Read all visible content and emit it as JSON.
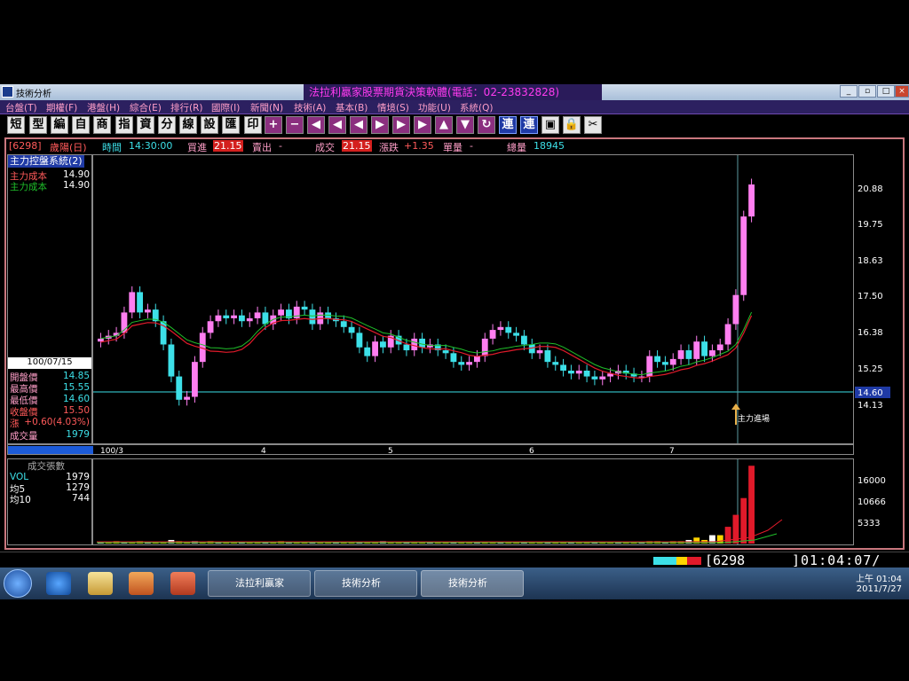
{
  "window": {
    "title": "技術分析",
    "banner": "法拉利贏家股票期貨決策軟體(電話：02-23832828)"
  },
  "menu": [
    "台盤(T)",
    "期權(F)",
    "港盤(H)",
    "綜合(E)",
    "排行(R)",
    "國際(I)",
    "新聞(N)",
    "技術(A)",
    "基本(B)",
    "情境(S)",
    "功能(U)",
    "系統(Q)"
  ],
  "toolbar": [
    "短",
    "型",
    "編",
    "自",
    "商",
    "指",
    "資",
    "分",
    "線",
    "設",
    "匯",
    "印",
    "+",
    "−",
    "◀",
    "◀",
    "◀",
    "▶",
    "▶",
    "▶",
    "▲",
    "▼",
    "↻",
    "連",
    "連",
    "▣",
    "🔒",
    "✂"
  ],
  "info": {
    "code": "[6298]",
    "name": "歲陽(日)",
    "time_label": "時間",
    "time": "14:30:00",
    "bid_label": "買進",
    "bid": "21.15",
    "ask_label": "賣出",
    "ask": "-",
    "trade_label": "成交",
    "trade": "21.15",
    "change_label": "漲跌",
    "change": "+1.35",
    "vol_label": "單量",
    "vol": "-",
    "total_label": "總量",
    "total": "18945"
  },
  "left": {
    "indicator": "主力控盤系統(2)",
    "cost1_label": "主力成本",
    "cost1": "14.90",
    "cost2_label": "主力成本",
    "cost2": "14.90",
    "date": "100/07/15",
    "open_label": "開盤價",
    "open": "14.85",
    "high_label": "最高價",
    "high": "15.55",
    "low_label": "最低價",
    "low": "14.60",
    "close_label": "收盤價",
    "close": "15.50",
    "chg_label": "漲",
    "chg": "+0.60(4.03%)",
    "volume_label": "成交量",
    "volume": "1979"
  },
  "price_axis": [
    "20.88",
    "19.75",
    "18.63",
    "17.50",
    "16.38",
    "15.25",
    "14.13"
  ],
  "current_price": "14.60",
  "annotation": "主力進場",
  "x_labels": [
    "100/3",
    "4",
    "5",
    "6",
    "7"
  ],
  "vol": {
    "title": "成交張數",
    "vol_label": "VOL",
    "vol": "1979",
    "ma5_label": "均5",
    "ma5": "1279",
    "ma10_label": "均10",
    "ma10": "744",
    "axis": [
      "16000",
      "10666",
      "5333"
    ]
  },
  "status": {
    "code": "[6298_",
    "clock": "]01:04:07/"
  },
  "taskbar": {
    "item1": "法拉利贏家",
    "item2": "技術分析",
    "item3": "技術分析",
    "time": "上午 01:04",
    "date": "2011/7/27"
  },
  "colors": {
    "up": "#ff7ef0",
    "down": "#3de0e8",
    "ma_green": "#1fbf2a",
    "ma_red": "#e01a2a"
  }
}
